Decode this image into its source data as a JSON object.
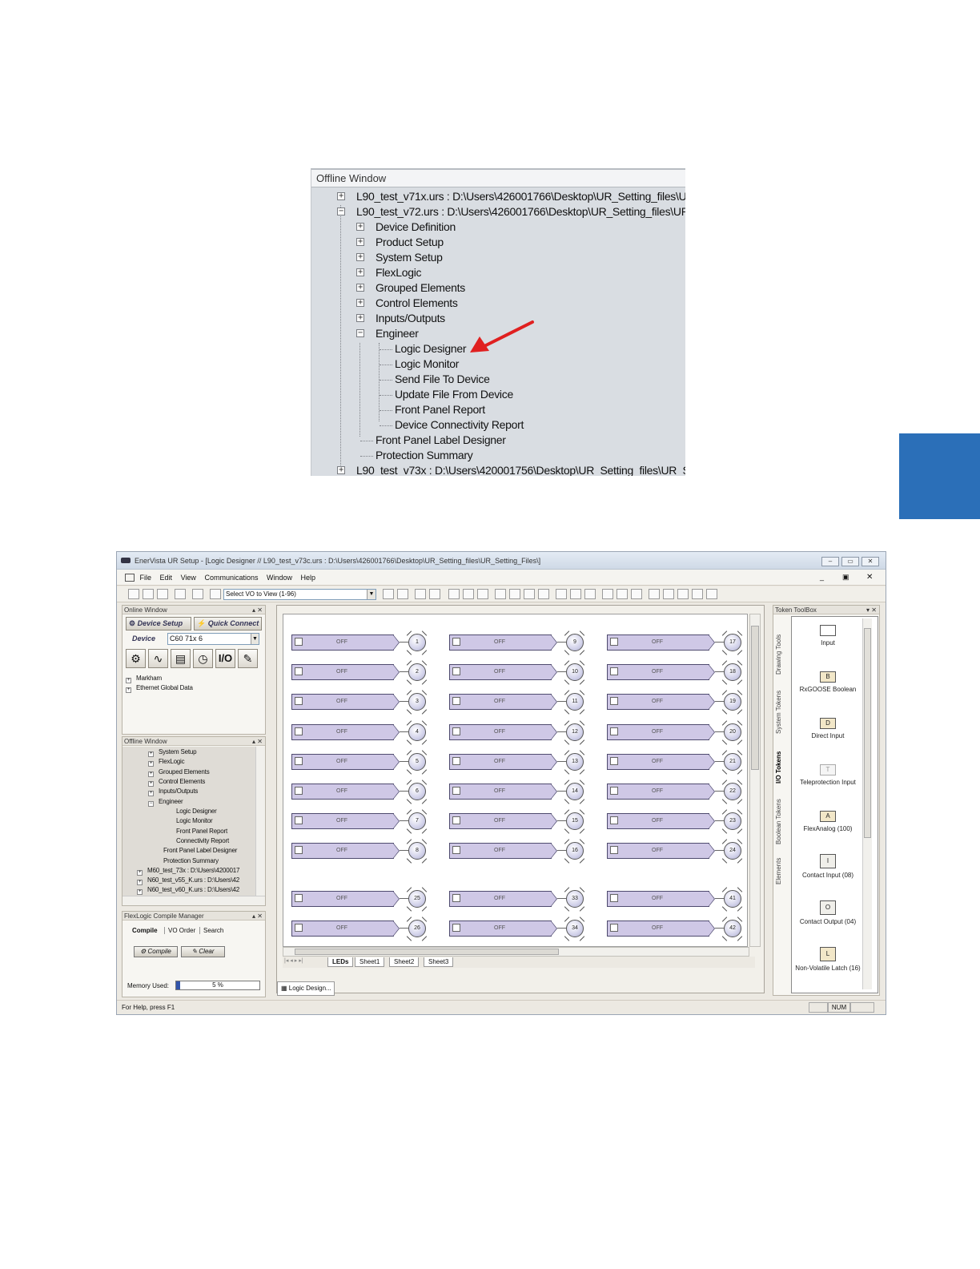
{
  "side_tab": {
    "color": "#2b6fb8"
  },
  "offline_window": {
    "header": "Offline Window",
    "items": [
      {
        "label": "L90_test_v71x.urs : D:\\Users\\426001766\\Desktop\\UR_Setting_files\\UR",
        "sign": "+"
      },
      {
        "label": "L90_test_v72.urs : D:\\Users\\426001766\\Desktop\\UR_Setting_files\\UR_",
        "sign": "−"
      },
      {
        "label": "Device Definition",
        "sign": "+"
      },
      {
        "label": "Product Setup",
        "sign": "+"
      },
      {
        "label": "System Setup",
        "sign": "+"
      },
      {
        "label": "FlexLogic",
        "sign": "+"
      },
      {
        "label": "Grouped Elements",
        "sign": "+"
      },
      {
        "label": "Control Elements",
        "sign": "+"
      },
      {
        "label": "Inputs/Outputs",
        "sign": "+"
      },
      {
        "label": "Engineer",
        "sign": "−"
      },
      {
        "label": "Logic Designer"
      },
      {
        "label": "Logic Monitor"
      },
      {
        "label": "Send File To Device"
      },
      {
        "label": "Update File From Device"
      },
      {
        "label": "Front Panel Report"
      },
      {
        "label": "Device Connectivity Report"
      },
      {
        "label": "Front Panel Label Designer"
      },
      {
        "label": "Protection Summary"
      },
      {
        "label": "L90_test_v73x : D:\\Users\\420001756\\Desktop\\UR_Setting_files\\UR_S",
        "sign": "+"
      }
    ],
    "arrow_color": "#e02020"
  },
  "app": {
    "title": "EnerVista UR Setup - [Logic Designer // L90_test_v73c.urs : D:\\Users\\426001766\\Desktop\\UR_Setting_files\\UR_Setting_Files\\]",
    "menu": [
      "File",
      "Edit",
      "View",
      "Communications",
      "Window",
      "Help"
    ],
    "view_select": "Select VO to View (1-96)",
    "online_window": {
      "header": "Online Window",
      "device_setup": "Device Setup",
      "quick_connect": "Quick Connect",
      "device_label": "Device",
      "device_value": "C60 71x 6",
      "io_label": "I/O",
      "tree": [
        "Markham",
        "Ethernet Global Data"
      ]
    },
    "offline_window": {
      "header": "Offline Window",
      "tree": [
        {
          "label": "System Setup",
          "sign": "+"
        },
        {
          "label": "FlexLogic",
          "sign": "+"
        },
        {
          "label": "Grouped Elements",
          "sign": "+"
        },
        {
          "label": "Control Elements",
          "sign": "+"
        },
        {
          "label": "Inputs/Outputs",
          "sign": "+"
        },
        {
          "label": "Engineer",
          "sign": "−"
        },
        {
          "label": "Logic Designer"
        },
        {
          "label": "Logic Monitor"
        },
        {
          "label": "Front Panel Report"
        },
        {
          "label": "Connectivity Report"
        },
        {
          "label": "Front Panel Label Designer"
        },
        {
          "label": "Protection Summary"
        },
        {
          "label": "M60_test_73x : D:\\Users\\4200017",
          "sign": "+"
        },
        {
          "label": "N60_test_v55_K.urs : D:\\Users\\42",
          "sign": "+"
        },
        {
          "label": "N60_test_v60_K.urs : D:\\Users\\42",
          "sign": "+"
        }
      ]
    },
    "compile_manager": {
      "header": "FlexLogic Compile Manager",
      "tabs": [
        "Compile",
        "VO Order",
        "Search"
      ],
      "compile_button": "Compile",
      "clear_button": "Clear",
      "memory_label": "Memory Used:",
      "memory_value": "5 %",
      "memory_fraction": 0.05
    },
    "canvas": {
      "off_label": "OFF",
      "columns": [
        [
          1,
          2,
          3,
          4,
          5,
          6,
          7,
          8
        ],
        [
          9,
          10,
          11,
          12,
          13,
          14,
          15,
          16
        ],
        [
          17,
          18,
          19,
          20,
          21,
          22,
          23,
          24
        ]
      ],
      "lower_columns": [
        [
          25,
          26
        ],
        [
          33,
          34
        ],
        [
          41,
          42
        ]
      ]
    },
    "sheet_tabs": [
      "LEDs",
      "Sheet1",
      "Sheet2",
      "Sheet3"
    ],
    "doc_tab": "Logic Design...",
    "toolbox": {
      "header": "Token ToolBox",
      "vertical_tabs": [
        "Drawing Tools",
        "System Tokens",
        "I/O Tokens",
        "Boolean Tokens",
        "Elements"
      ],
      "tools": [
        {
          "label": "Input",
          "icon": "input-icon",
          "glyph": ""
        },
        {
          "label": "RxGOOSE Boolean",
          "icon": "rxgoose-icon",
          "glyph": "B"
        },
        {
          "label": "Direct Input",
          "icon": "direct-input-icon",
          "glyph": "D"
        },
        {
          "label": "Teleprotection Input",
          "icon": "teleprotection-icon",
          "glyph": "T"
        },
        {
          "label": "FlexAnalog (100)",
          "icon": "flexanalog-icon",
          "glyph": "A"
        },
        {
          "label": "Contact Input (08)",
          "icon": "contact-input-icon",
          "glyph": "I"
        },
        {
          "label": "Contact Output (04)",
          "icon": "contact-output-icon",
          "glyph": "O"
        },
        {
          "label": "Non-Volatile Latch (16)",
          "icon": "latch-icon",
          "glyph": "L"
        }
      ]
    },
    "status": {
      "help": "For Help, press F1",
      "num": "NUM"
    }
  }
}
